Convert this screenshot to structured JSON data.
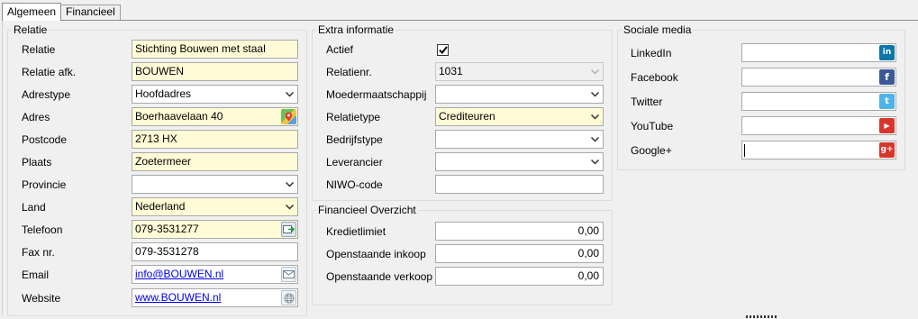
{
  "tabs": [
    {
      "label": "Algemeen",
      "active": true
    },
    {
      "label": "Financieel",
      "active": false
    }
  ],
  "relatie": {
    "title": "Relatie",
    "rows": [
      {
        "label": "Relatie",
        "value": "Stichting Bouwen met staal"
      },
      {
        "label": "Relatie afk.",
        "value": "BOUWEN"
      },
      {
        "label": "Adrestype",
        "value": "Hoofdadres"
      },
      {
        "label": "Adres",
        "value": "Boerhaavelaan 40"
      },
      {
        "label": "Postcode",
        "value": "2713 HX"
      },
      {
        "label": "Plaats",
        "value": "Zoetermeer"
      },
      {
        "label": "Provincie",
        "value": ""
      },
      {
        "label": "Land",
        "value": "Nederland"
      },
      {
        "label": "Telefoon",
        "value": "079-3531277"
      },
      {
        "label": "Fax nr.",
        "value": "079-3531278"
      },
      {
        "label": "Email",
        "value": "info@BOUWEN.nl"
      },
      {
        "label": "Website",
        "value": "www.BOUWEN.nl"
      }
    ]
  },
  "extra": {
    "title": "Extra informatie",
    "rows": [
      {
        "label": "Actief",
        "checked": true
      },
      {
        "label": "Relatienr.",
        "value": "1031"
      },
      {
        "label": "Moedermaatschappij",
        "value": ""
      },
      {
        "label": "Relatietype",
        "value": "Crediteuren"
      },
      {
        "label": "Bedrijfstype",
        "value": ""
      },
      {
        "label": "Leverancier",
        "value": ""
      },
      {
        "label": "NIWO-code",
        "value": ""
      }
    ]
  },
  "financieel": {
    "title": "Financieel Overzicht",
    "rows": [
      {
        "label": "Kredietlimiet",
        "value": "0,00"
      },
      {
        "label": "Openstaande inkoop",
        "value": "0,00"
      },
      {
        "label": "Openstaande verkoop",
        "value": "0,00"
      }
    ]
  },
  "social": {
    "title": "Sociale media",
    "rows": [
      {
        "label": "LinkedIn",
        "value": "",
        "icon": "linkedin-icon",
        "glyph": "in",
        "color": "#0e76a8"
      },
      {
        "label": "Facebook",
        "value": "",
        "icon": "facebook-icon",
        "glyph": "f",
        "color": "#3b5998"
      },
      {
        "label": "Twitter",
        "value": "",
        "icon": "twitter-icon",
        "glyph": "t",
        "color": "#4fb3e8"
      },
      {
        "label": "YouTube",
        "value": "",
        "icon": "youtube-icon",
        "glyph": "▶",
        "color": "#d9362b"
      },
      {
        "label": "Google+",
        "value": "",
        "icon": "google-plus-icon",
        "glyph": "g+",
        "color": "#d9362b"
      }
    ]
  },
  "colors": {
    "required_field": "#fffbd6",
    "link": "#0000ee"
  }
}
